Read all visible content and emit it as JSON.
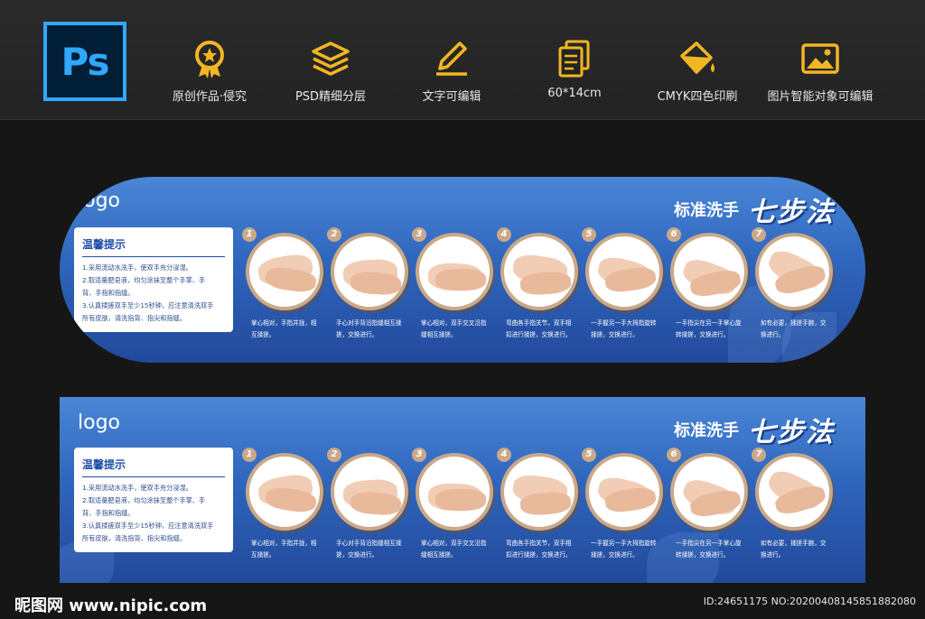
{
  "toolbar": {
    "app_badge": "Ps",
    "features": [
      {
        "icon": "award-medal-icon",
        "label": "原创作品·侵究"
      },
      {
        "icon": "layers-icon",
        "label": "PSD精细分层"
      },
      {
        "icon": "pencil-edit-icon",
        "label": "文字可编辑"
      },
      {
        "icon": "document-copy-icon",
        "label": "60*14cm"
      },
      {
        "icon": "paint-bucket-icon",
        "label": "CMYK四色印刷"
      },
      {
        "icon": "image-icon",
        "label": "图片智能对象可编辑"
      }
    ],
    "accent": "#f3b623"
  },
  "panel": {
    "logo": "logo",
    "title": "标准洗手",
    "title_script": "七步法",
    "tips_title": "温馨提示",
    "tips": [
      "1.采用流动水洗手，使双手充分浸湿。",
      "2.取适量肥皂液，均匀涂抹至整个手掌、手",
      "背、手指和指缝。",
      "3.认真揉搓双手至少15秒钟，应注意清洗双手",
      "所有皮肤，清洗指背、指尖和指缝。"
    ],
    "steps_p1": [
      {
        "num": "1",
        "caption": [
          "掌心相对，手指并拢，相",
          "互揉搓。"
        ]
      },
      {
        "num": "2",
        "caption": [
          "手心对手背沿指缝相互揉",
          "搓，交换进行。"
        ]
      },
      {
        "num": "3",
        "caption": [
          "掌心相对，双手交叉沿指",
          "缝相互揉搓。"
        ]
      },
      {
        "num": "4",
        "caption": [
          "弯曲各手指关节，双手相",
          "扣进行揉搓，交换进行。"
        ]
      },
      {
        "num": "5",
        "caption": [
          "一手握另一手大拇指旋转",
          "揉搓，交换进行。"
        ]
      },
      {
        "num": "6",
        "caption": [
          "一手指尖在另一手掌心旋",
          "转揉搓，交换进行。"
        ]
      },
      {
        "num": "7",
        "caption": [
          "如有必要，揉搓手腕，交",
          "换进行。"
        ]
      }
    ],
    "steps_p2": [
      {
        "num": "1",
        "caption": [
          "掌心相对，手指并拢，相",
          "互揉搓。"
        ]
      },
      {
        "num": "2",
        "caption": [
          "手心对手背沿指缝相互揉",
          "搓，交换进行。"
        ]
      },
      {
        "num": "3",
        "caption": [
          "掌心相对，双手交叉沿指",
          "缝相互揉搓。"
        ]
      },
      {
        "num": "4",
        "caption": [
          "弯曲各手指关节，双手相",
          "扣进行揉搓，交换进行。"
        ]
      },
      {
        "num": "5",
        "caption": [
          "一手握另一手大拇指旋转",
          "揉搓，交换进行。"
        ]
      },
      {
        "num": "6",
        "caption": [
          "一手指尖在另一手掌心旋",
          "转揉搓，交换进行。"
        ]
      },
      {
        "num": "7",
        "caption": [
          "如有必要，揉搓手腕，交",
          "换进行。"
        ]
      }
    ]
  },
  "footer": {
    "site": "昵图网 www.nipic.com",
    "image_id": "ID:24651175 NO:20200408145851882080"
  }
}
